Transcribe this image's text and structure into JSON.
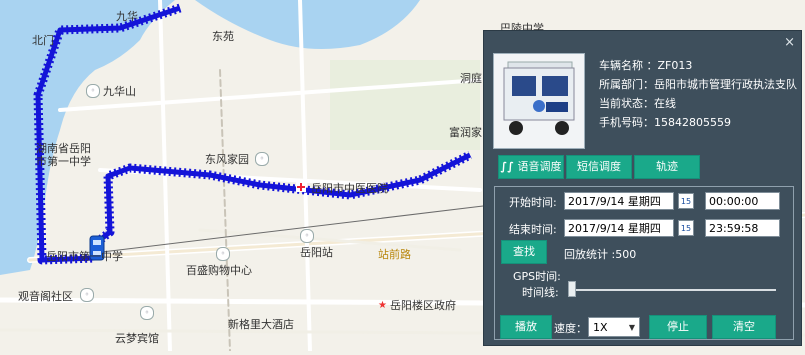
{
  "map": {
    "labels": {
      "jiuhua": "九华山",
      "dongyuan": "东苑",
      "dongfeng": "东风家园",
      "tcm_hospital": "岳阳市中医医院",
      "hunan_school": "湖南省岳阳",
      "hunan_school2": "市第一中学",
      "yuyang_st": "岳阳站",
      "zhanqian_rd": "站前路",
      "baisheng": "百盛购物中心",
      "guanyinge": "观音阁社区",
      "yunmeng": "云梦宾馆",
      "xingeli": "新格里大酒店",
      "yueyang_gov": "岳阳楼区政府",
      "dongting": "洞庭",
      "fuqiang": "富润家",
      "north_gate": "北门",
      "top_label": "九华",
      "school_label": "岳阳市第一中学",
      "middle_school": "巴陵中学"
    }
  },
  "panel": {
    "close": "×",
    "vehicle_name": "车辆名称 ：ZF013",
    "department": "所属部门：岳阳市城市管理行政执法支队",
    "status": "当前状态：在线",
    "phone": "手机号码：15842805559",
    "btn_voice": "语音调度",
    "btn_sms": "短信调度",
    "btn_track": "轨迹",
    "start_label": "开始时间:",
    "start_date": "2017/9/14 星期四",
    "start_time": "00:00:00",
    "end_label": "结束时间:",
    "end_date": "2017/9/14 星期四",
    "end_time": "23:59:58",
    "cal_day": "15",
    "btn_search": "查找",
    "playback_stat": "回放统计 :500",
    "gps_time_label": "GPS时间:",
    "timeline_label": "时间线:",
    "timeline_position": 0.0,
    "btn_play": "播放",
    "speed_label": "速度：",
    "speed_value": "1X",
    "btn_stop": "停止",
    "btn_clear": "清空"
  },
  "colors": {
    "track": "#1414d8",
    "panel_bg": "#3e4f5c",
    "button": "#1aa98a",
    "water": "#a9d3f1",
    "road_major": "#ffffff",
    "road_minor": "#e8e4d8"
  },
  "icons": {
    "close": "close-icon",
    "voice": "voice-icon",
    "calendar": "calendar-icon",
    "car": "car-icon",
    "hospital": "hospital-icon"
  }
}
